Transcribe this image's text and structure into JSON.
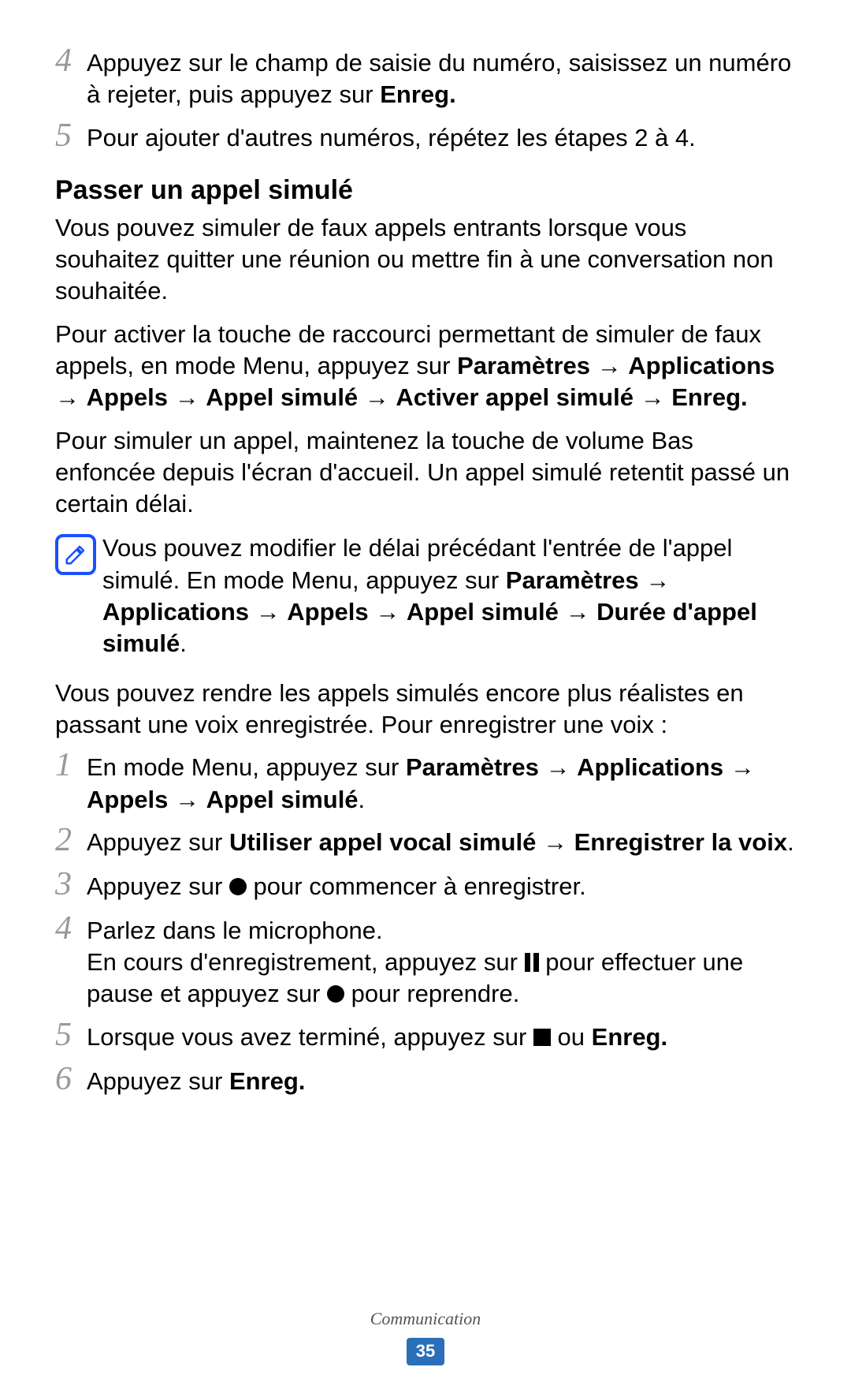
{
  "top_steps": {
    "s4": {
      "num": "4",
      "text_a": "Appuyez sur le champ de saisie du numéro, saisissez un numéro à rejeter, puis appuyez sur ",
      "text_b": "Enreg."
    },
    "s5": {
      "num": "5",
      "text": "Pour ajouter d'autres numéros, répétez les étapes 2 à 4."
    }
  },
  "section": {
    "heading": "Passer un appel simulé",
    "p1": "Vous pouvez simuler de faux appels entrants lorsque vous souhaitez quitter une réunion ou mettre fin à une conversation non souhaitée.",
    "p2a": "Pour activer la touche de raccourci permettant de simuler de faux appels, en mode Menu, appuyez sur ",
    "p2b": "Paramètres",
    "p2c": "Applications",
    "p2d": "Appels",
    "p2e": "Appel simulé",
    "p2f": "Activer appel simulé",
    "p2g": "Enreg.",
    "p3": "Pour simuler un appel, maintenez la touche de volume Bas enfoncée depuis l'écran d'accueil. Un appel simulé retentit passé un certain délai."
  },
  "note": {
    "t1": "Vous pouvez modifier le délai précédant l'entrée de l'appel simulé. En mode Menu, appuyez sur ",
    "b1": "Paramètres",
    "b2": "Applications",
    "b3": "Appels",
    "b4": "Appel simulé",
    "b5": "Durée d'appel simulé",
    "dot": "."
  },
  "p4": "Vous pouvez rendre les appels simulés encore plus réalistes en passant une voix enregistrée. Pour enregistrer une voix :",
  "arrow": "→",
  "steps2": {
    "s1": {
      "num": "1",
      "a": "En mode Menu, appuyez sur ",
      "b1": "Paramètres",
      "b2": "Applications",
      "b3": "Appels",
      "b4": "Appel simulé",
      "dot": "."
    },
    "s2": {
      "num": "2",
      "a": "Appuyez sur ",
      "b1": "Utiliser appel vocal simulé",
      "b2": "Enregistrer la voix",
      "dot": "."
    },
    "s3": {
      "num": "3",
      "a": "Appuyez sur ",
      "b": " pour commencer à enregistrer."
    },
    "s4": {
      "num": "4",
      "a": "Parlez dans le microphone.",
      "b": "En cours d'enregistrement, appuyez sur ",
      "c": " pour effectuer une pause et appuyez sur ",
      "d": " pour reprendre."
    },
    "s5": {
      "num": "5",
      "a": "Lorsque vous avez terminé, appuyez sur ",
      "b": " ou ",
      "c": "Enreg."
    },
    "s6": {
      "num": "6",
      "a": "Appuyez sur ",
      "b": "Enreg."
    }
  },
  "footer": {
    "label": "Communication",
    "page": "35"
  }
}
